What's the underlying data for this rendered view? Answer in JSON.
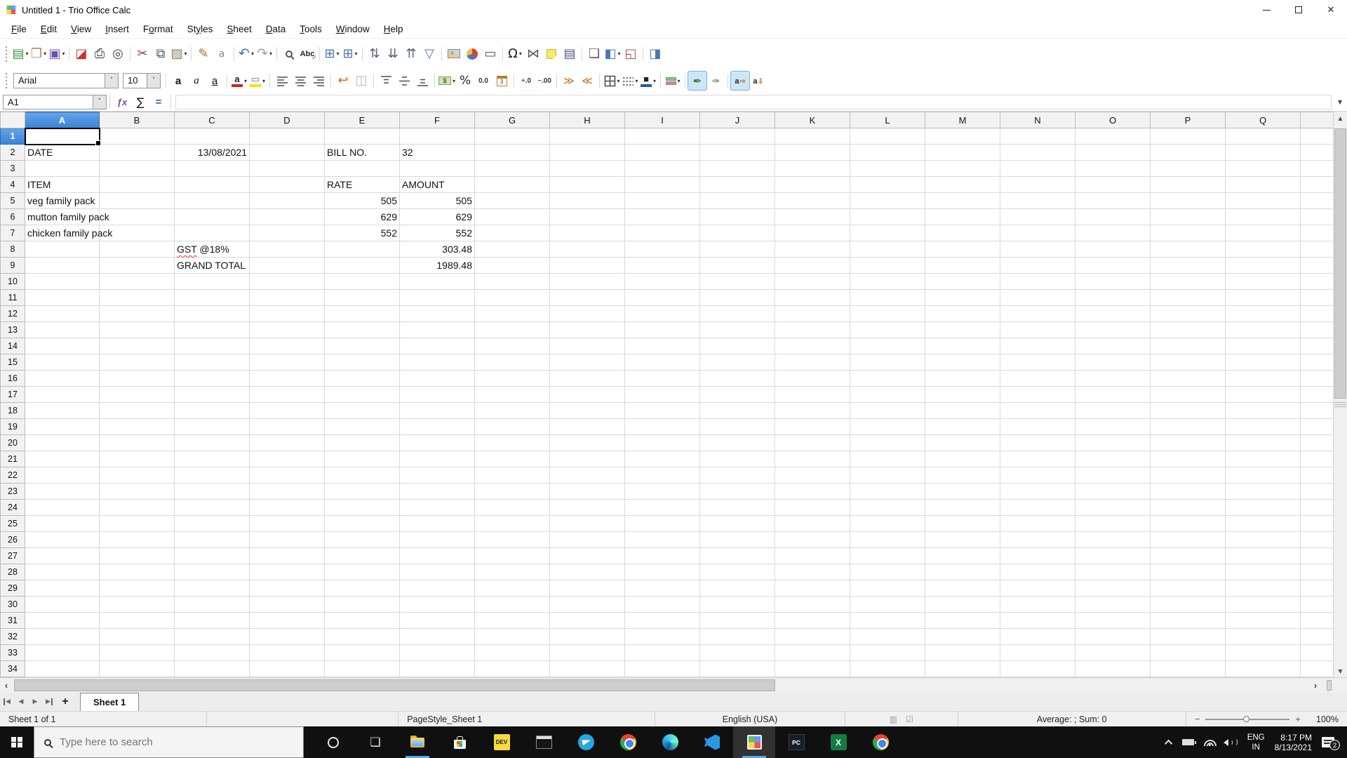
{
  "window": {
    "title": "Untitled 1 - Trio Office Calc"
  },
  "menu": {
    "items": [
      {
        "label": "File",
        "accel": 0
      },
      {
        "label": "Edit",
        "accel": 0
      },
      {
        "label": "View",
        "accel": 0
      },
      {
        "label": "Insert",
        "accel": 0
      },
      {
        "label": "Format",
        "accel": 1
      },
      {
        "label": "Styles",
        "accel": 2
      },
      {
        "label": "Sheet",
        "accel": 0
      },
      {
        "label": "Data",
        "accel": 0
      },
      {
        "label": "Tools",
        "accel": 0
      },
      {
        "label": "Window",
        "accel": 0
      },
      {
        "label": "Help",
        "accel": 0
      }
    ]
  },
  "toolbar_standard": {
    "items": [
      {
        "icon": "new-document",
        "dd": true
      },
      {
        "icon": "open",
        "dd": true
      },
      {
        "icon": "save",
        "dd": true
      },
      {
        "sep": true
      },
      {
        "icon": "export-pdf"
      },
      {
        "icon": "print"
      },
      {
        "icon": "print-preview"
      },
      {
        "sep": true
      },
      {
        "icon": "cut"
      },
      {
        "icon": "copy"
      },
      {
        "icon": "paste",
        "dd": true
      },
      {
        "sep": true
      },
      {
        "icon": "clone-formatting"
      },
      {
        "icon": "clear-formatting"
      },
      {
        "sep": true
      },
      {
        "icon": "undo",
        "dd": true
      },
      {
        "icon": "redo",
        "dd": true
      },
      {
        "sep": true
      },
      {
        "icon": "find-and-replace"
      },
      {
        "icon": "spelling"
      },
      {
        "sep": true
      },
      {
        "icon": "insert-row",
        "dd": true
      },
      {
        "icon": "insert-column",
        "dd": true
      },
      {
        "sep": true
      },
      {
        "icon": "sort"
      },
      {
        "icon": "sort-ascending"
      },
      {
        "icon": "sort-descending"
      },
      {
        "icon": "autofilter"
      },
      {
        "sep": true
      },
      {
        "icon": "insert-image"
      },
      {
        "icon": "insert-chart"
      },
      {
        "icon": "insert-text-box"
      },
      {
        "sep": true
      },
      {
        "icon": "special-character",
        "dd": true
      },
      {
        "icon": "insert-hyperlink"
      },
      {
        "icon": "insert-comment"
      },
      {
        "icon": "headers-and-footers"
      },
      {
        "sep": true
      },
      {
        "icon": "show-draw-functions"
      },
      {
        "icon": "freeze-rows-and-columns",
        "dd": true
      },
      {
        "icon": "split-window"
      },
      {
        "sep": true
      },
      {
        "icon": "sidebar"
      }
    ]
  },
  "toolbar_formatting": {
    "font_name": "Arial",
    "font_size": "10",
    "items": [
      {
        "icon": "bold"
      },
      {
        "icon": "italic"
      },
      {
        "icon": "underline"
      },
      {
        "sep": true
      },
      {
        "icon": "font-color",
        "dd": true
      },
      {
        "icon": "highlighting-color",
        "dd": true
      },
      {
        "sep": true
      },
      {
        "icon": "align-left"
      },
      {
        "icon": "align-center"
      },
      {
        "icon": "align-right"
      },
      {
        "sep": true
      },
      {
        "icon": "wrap-text"
      },
      {
        "icon": "merge-cells"
      },
      {
        "sep": true
      },
      {
        "icon": "align-top"
      },
      {
        "icon": "center-vertically"
      },
      {
        "icon": "align-bottom"
      },
      {
        "sep": true
      },
      {
        "icon": "format-as-currency",
        "dd": true
      },
      {
        "icon": "format-as-percent"
      },
      {
        "icon": "format-as-number"
      },
      {
        "icon": "format-as-date"
      },
      {
        "sep": true
      },
      {
        "icon": "add-decimal-place"
      },
      {
        "icon": "delete-decimal-place"
      },
      {
        "sep": true
      },
      {
        "icon": "increase-indent"
      },
      {
        "icon": "decrease-indent"
      },
      {
        "sep": true
      },
      {
        "icon": "borders",
        "dd": true
      },
      {
        "icon": "border-style",
        "dd": true
      },
      {
        "icon": "border-color",
        "dd": true
      },
      {
        "sep": true
      },
      {
        "icon": "conditional-formatting",
        "dd": true
      },
      {
        "sep": true
      },
      {
        "icon": "paragraph-left-to-right",
        "active": true
      },
      {
        "icon": "paragraph-right-to-left"
      },
      {
        "sep": true
      },
      {
        "icon": "text-direction-left-to-right",
        "active": true
      },
      {
        "icon": "text-direction-top-to-bottom"
      }
    ]
  },
  "formula_bar": {
    "cell_reference": "A1",
    "input_value": ""
  },
  "grid": {
    "columns": [
      "A",
      "B",
      "C",
      "D",
      "E",
      "F",
      "G",
      "H",
      "I",
      "J",
      "K",
      "L",
      "M",
      "N",
      "O",
      "P",
      "Q"
    ],
    "row_count": 37,
    "selected_cell": "A1",
    "selected_column": "A",
    "selected_row": "1",
    "cells": [
      {
        "ref": "A2",
        "text": "DATE",
        "align": "left"
      },
      {
        "ref": "C2",
        "text": "13/08/2021",
        "align": "right"
      },
      {
        "ref": "E2",
        "text": "BILL NO.",
        "align": "left"
      },
      {
        "ref": "F2",
        "text": "32",
        "align": "left"
      },
      {
        "ref": "A4",
        "text": "ITEM",
        "align": "left"
      },
      {
        "ref": "E4",
        "text": "RATE",
        "align": "left"
      },
      {
        "ref": "F4",
        "text": "AMOUNT",
        "align": "left"
      },
      {
        "ref": "A5",
        "text": "veg family pack",
        "align": "left"
      },
      {
        "ref": "E5",
        "text": "505",
        "align": "right"
      },
      {
        "ref": "F5",
        "text": "505",
        "align": "right"
      },
      {
        "ref": "A6",
        "text": "mutton family pack",
        "align": "left"
      },
      {
        "ref": "E6",
        "text": "629",
        "align": "right"
      },
      {
        "ref": "F6",
        "text": "629",
        "align": "right"
      },
      {
        "ref": "A7",
        "text": "chicken family pack",
        "align": "left"
      },
      {
        "ref": "E7",
        "text": "552",
        "align": "right"
      },
      {
        "ref": "F7",
        "text": "552",
        "align": "right"
      },
      {
        "ref": "C8",
        "text": "GST @18%",
        "align": "left",
        "misspelled": "GST"
      },
      {
        "ref": "F8",
        "text": "303.48",
        "align": "right"
      },
      {
        "ref": "C9",
        "text": "GRAND TOTAL",
        "align": "left"
      },
      {
        "ref": "F9",
        "text": "1989.48",
        "align": "right"
      }
    ]
  },
  "sheet_tabs": {
    "active_tab": "Sheet 1"
  },
  "status_bar": {
    "sheet_position": "Sheet 1 of 1",
    "page_style": "PageStyle_Sheet 1",
    "language": "English (USA)",
    "selection_stats": "Average: ; Sum: 0",
    "zoom_level": "100%"
  },
  "taskbar": {
    "search_placeholder": "Type here to search",
    "apps": [
      "cortana",
      "task-view",
      "file-explorer",
      "microsoft-store",
      "dev",
      "terminal",
      "telegram",
      "chrome",
      "edge",
      "vscode",
      "trio-office-calc",
      "pc-app",
      "excel",
      "chrome-2"
    ],
    "open_apps": [
      "file-explorer",
      "trio-office-calc"
    ],
    "active_app": "trio-office-calc",
    "tray": {
      "language_line1": "ENG",
      "language_line2": "IN",
      "time": "8:17 PM",
      "date": "8/13/2021",
      "notification_count": "2"
    }
  }
}
